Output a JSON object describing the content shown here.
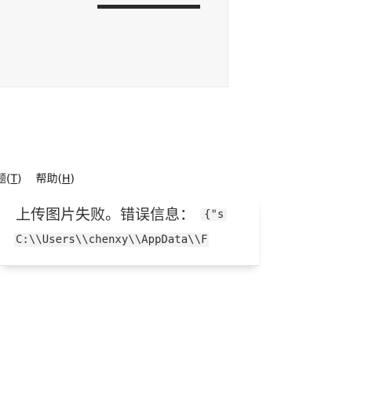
{
  "menubar": {
    "items": [
      {
        "prefix": "题(",
        "mnemonic": "T",
        "suffix": ")"
      },
      {
        "prefix": "帮助(",
        "mnemonic": "H",
        "suffix": ")"
      }
    ]
  },
  "panel": {
    "message": "上传图片失败。错误信息：",
    "code_inline": "{\"s",
    "code_path": "C:\\\\Users\\\\chenxy\\\\AppData\\\\F"
  }
}
